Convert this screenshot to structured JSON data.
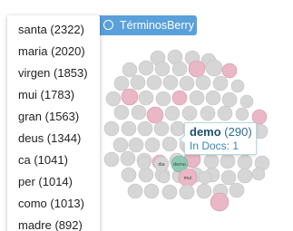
{
  "tab": {
    "label": "TérminosBerry",
    "icon": "radio-icon"
  },
  "word_list": [
    {
      "word": "santa",
      "count": 2322,
      "text": "santa (2322)"
    },
    {
      "word": "maria",
      "count": 2020,
      "text": "maria (2020)"
    },
    {
      "word": "virgen",
      "count": 1853,
      "text": "virgen (1853)"
    },
    {
      "word": "mui",
      "count": 1783,
      "text": "mui (1783)"
    },
    {
      "word": "gran",
      "count": 1563,
      "text": "gran (1563)"
    },
    {
      "word": "deus",
      "count": 1344,
      "text": "deus (1344)"
    },
    {
      "word": "ca",
      "count": 1041,
      "text": "ca (1041)"
    },
    {
      "word": "per",
      "count": 1014,
      "text": "per (1014)"
    },
    {
      "word": "como",
      "count": 1013,
      "text": "como (1013)"
    },
    {
      "word": "madre",
      "count": 892,
      "text": "madre (892)"
    }
  ],
  "bubbles": [
    {
      "label": "",
      "tone": "grey"
    },
    {
      "label": "",
      "tone": "grey"
    },
    {
      "label": "",
      "tone": "grey"
    },
    {
      "label": "",
      "tone": "grey"
    },
    {
      "label": "",
      "tone": "grey"
    },
    {
      "label": "",
      "tone": "grey"
    },
    {
      "label": "",
      "tone": "grey"
    },
    {
      "label": "",
      "tone": "grey"
    },
    {
      "label": "",
      "tone": "pink"
    },
    {
      "label": "",
      "tone": "grey"
    },
    {
      "label": "",
      "tone": "pink"
    },
    {
      "label": "",
      "tone": "grey"
    },
    {
      "label": "",
      "tone": "grey"
    },
    {
      "label": "",
      "tone": "grey"
    },
    {
      "label": "",
      "tone": "grey"
    },
    {
      "label": "",
      "tone": "grey"
    },
    {
      "label": "",
      "tone": "grey"
    },
    {
      "label": "",
      "tone": "grey"
    },
    {
      "label": "",
      "tone": "grey"
    },
    {
      "label": "",
      "tone": "grey"
    },
    {
      "label": "",
      "tone": "pink"
    },
    {
      "label": "",
      "tone": "grey"
    },
    {
      "label": "",
      "tone": "grey"
    },
    {
      "label": "",
      "tone": "pink"
    },
    {
      "label": "",
      "tone": "grey"
    },
    {
      "label": "",
      "tone": "grey"
    },
    {
      "label": "",
      "tone": "grey"
    },
    {
      "label": "",
      "tone": "grey"
    },
    {
      "label": "",
      "tone": "grey"
    },
    {
      "label": "",
      "tone": "grey"
    },
    {
      "label": "",
      "tone": "pink"
    },
    {
      "label": "",
      "tone": "grey"
    },
    {
      "label": "",
      "tone": "grey"
    },
    {
      "label": "",
      "tone": "grey"
    },
    {
      "label": "",
      "tone": "grey"
    },
    {
      "label": "",
      "tone": "grey"
    },
    {
      "label": "",
      "tone": "pink"
    },
    {
      "label": "",
      "tone": "grey"
    },
    {
      "label": "",
      "tone": "grey"
    },
    {
      "label": "",
      "tone": "grey"
    },
    {
      "label": "",
      "tone": "grey"
    },
    {
      "label": "",
      "tone": "grey"
    },
    {
      "label": "",
      "tone": "grey"
    },
    {
      "label": "",
      "tone": "grey"
    },
    {
      "label": "",
      "tone": "grey"
    },
    {
      "label": "",
      "tone": "grey"
    },
    {
      "label": "",
      "tone": "grey"
    },
    {
      "label": "",
      "tone": "grey"
    },
    {
      "label": "",
      "tone": "grey"
    },
    {
      "label": "",
      "tone": "grey"
    },
    {
      "label": "",
      "tone": "grey"
    },
    {
      "label": "",
      "tone": "grey"
    },
    {
      "label": "",
      "tone": "grey"
    },
    {
      "label": "",
      "tone": "pink"
    },
    {
      "label": "",
      "tone": "grey"
    },
    {
      "label": "",
      "tone": "pink"
    },
    {
      "label": "",
      "tone": "grey"
    },
    {
      "label": "",
      "tone": "grey"
    },
    {
      "label": "",
      "tone": "grey"
    },
    {
      "label": "",
      "tone": "grey"
    },
    {
      "label": "",
      "tone": "grey"
    },
    {
      "label": "",
      "tone": "grey"
    },
    {
      "label": "",
      "tone": "grey"
    },
    {
      "label": "",
      "tone": "grey"
    },
    {
      "label": "",
      "tone": "grey"
    },
    {
      "label": "",
      "tone": "grey"
    },
    {
      "label": "demo",
      "tone": "teal"
    },
    {
      "label": "dia",
      "tone": "grey"
    },
    {
      "label": "",
      "tone": "grey"
    },
    {
      "label": "",
      "tone": "grey"
    },
    {
      "label": "",
      "tone": "grey"
    },
    {
      "label": "",
      "tone": "grey"
    },
    {
      "label": "",
      "tone": "grey"
    },
    {
      "label": "",
      "tone": "grey"
    },
    {
      "label": "",
      "tone": "grey"
    },
    {
      "label": "mui",
      "tone": "pink"
    },
    {
      "label": "",
      "tone": "grey"
    },
    {
      "label": "",
      "tone": "grey"
    },
    {
      "label": "",
      "tone": "grey"
    },
    {
      "label": "",
      "tone": "grey"
    },
    {
      "label": "",
      "tone": "grey"
    },
    {
      "label": "",
      "tone": "grey"
    },
    {
      "label": "",
      "tone": "pink"
    }
  ],
  "tooltip": {
    "word": "demo",
    "count_text": "(290)",
    "docs_text": "In Docs: 1"
  },
  "colors": {
    "grey": "#d6d6d6",
    "grey_stroke": "#c2c2c2",
    "pink": "#e9b7c6",
    "pink_stroke": "#d796aa",
    "teal": "#8dc9b3",
    "teal_stroke": "#6fb29b",
    "tab": "#5aa0db"
  }
}
